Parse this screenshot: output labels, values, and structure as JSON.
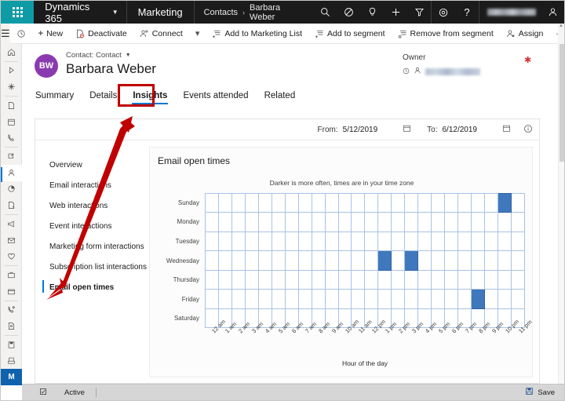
{
  "topnav": {
    "waffle_icon": "waffle-grid-icon",
    "brand": "Dynamics 365",
    "brand_chevron": "chevron-down-icon",
    "app_name": "Marketing",
    "breadcrumb": {
      "parent": "Contacts",
      "separator": "›",
      "current": "Barbara Weber"
    },
    "icons": [
      "search-icon",
      "focus-assist-icon",
      "lightbulb-idea-icon",
      "plus-new-icon",
      "filter-icon",
      "gear-settings-icon",
      "help-question-icon"
    ],
    "user_name_redacted": "",
    "person_icon": "person-icon"
  },
  "commandbar": {
    "hamburger_icon": "hamburger-menu-icon",
    "history_icon": "recent-history-icon",
    "buttons": [
      {
        "label": "New",
        "icon": "plus-icon"
      },
      {
        "label": "Deactivate",
        "icon": "deactivate-icon"
      },
      {
        "label": "Connect",
        "icon": "connect-icon"
      },
      {
        "label": "",
        "icon": "chevron-down-icon"
      },
      {
        "label": "Add to Marketing List",
        "icon": "add-list-icon"
      },
      {
        "label": "Add to segment",
        "icon": "add-segment-icon"
      },
      {
        "label": "Remove from segment",
        "icon": "remove-segment-icon"
      },
      {
        "label": "Assign",
        "icon": "assign-person-icon"
      },
      {
        "label": "···",
        "icon": "overflow-ellipsis-icon"
      }
    ]
  },
  "rail": {
    "items": [
      {
        "icon": "home-icon",
        "name": "home"
      },
      {
        "icon": "recent-icon",
        "name": "recent"
      },
      {
        "icon": "pinned-icon",
        "name": "pinned"
      },
      {
        "icon": "page-icon",
        "name": "page"
      },
      {
        "icon": "calendar-icon",
        "name": "calendar"
      },
      {
        "icon": "phone-icon",
        "name": "phone-calls"
      },
      {
        "icon": "share-icon",
        "name": "activities"
      },
      {
        "icon": "contact-person-icon",
        "name": "contacts"
      },
      {
        "icon": "pie-chart-icon",
        "name": "dashboards"
      },
      {
        "icon": "document-report-icon",
        "name": "reports"
      },
      {
        "icon": "megaphone-icon",
        "name": "campaigns"
      },
      {
        "icon": "envelope-icon",
        "name": "emails"
      },
      {
        "icon": "heart-icon",
        "name": "leads"
      },
      {
        "icon": "briefcase-icon",
        "name": "accounts"
      },
      {
        "icon": "folder-icon",
        "name": "folders"
      },
      {
        "icon": "phone-link-icon",
        "name": "phone-link"
      },
      {
        "icon": "form-person-icon",
        "name": "marketing-forms"
      },
      {
        "icon": "save-page-icon",
        "name": "saved-pages"
      },
      {
        "icon": "printer-icon",
        "name": "print"
      },
      {
        "icon": "calculator-icon",
        "name": "calculator"
      }
    ],
    "selected_index": 7,
    "badge": "M"
  },
  "record": {
    "avatar_initials": "BW",
    "type_label": "Contact: Contact",
    "type_chevron": "chevron-down-icon",
    "name": "Barbara Weber",
    "owner_label": "Owner",
    "owner_lookup_icon": "lookup-clock-icon",
    "owner_person_icon": "person-icon",
    "required_marker": "✱"
  },
  "tabs": {
    "items": [
      "Summary",
      "Details",
      "Insights",
      "Events attended",
      "Related"
    ],
    "active": "Insights",
    "highlight_color": "#c00000"
  },
  "insights": {
    "daterange": {
      "from_label": "From:",
      "from_value": "5/12/2019",
      "from_calendar_icon": "calendar-icon",
      "to_label": "To:",
      "to_value": "6/12/2019",
      "to_calendar_icon": "calendar-icon",
      "info_icon": "info-circle-icon"
    },
    "sidelist": {
      "items": [
        "Overview",
        "Email interactions",
        "Web interactions",
        "Event interactions",
        "Marketing form interactions",
        "Subscription list interactions",
        "Email open times"
      ],
      "selected": "Email open times"
    }
  },
  "chart_data": {
    "type": "heatmap",
    "title": "Email open times",
    "subtitle": "Darker is more often, times are in your time zone",
    "xlabel": "Hour of the day",
    "ylabel": "",
    "grid": true,
    "cell_color_on": "#3f78bd",
    "cell_color_off": "#ffffff",
    "grid_line_color": "#a9c3e4",
    "categories": [
      "12 am",
      "1 am",
      "2 am",
      "3 am",
      "4 am",
      "5 am",
      "6 am",
      "7 am",
      "8 am",
      "9 am",
      "10 am",
      "11 am",
      "12 pm",
      "1 pm",
      "2 pm",
      "3 pm",
      "4 pm",
      "5 pm",
      "6 pm",
      "7 pm",
      "8 pm",
      "9 pm",
      "10 pm",
      "11 pm"
    ],
    "rows": [
      "Sunday",
      "Monday",
      "Tuesday",
      "Wednesday",
      "Thursday",
      "Friday",
      "Saturday"
    ],
    "values": [
      [
        0,
        0,
        0,
        0,
        0,
        0,
        0,
        0,
        0,
        0,
        0,
        0,
        0,
        0,
        0,
        0,
        0,
        0,
        0,
        0,
        0,
        0,
        1,
        0
      ],
      [
        0,
        0,
        0,
        0,
        0,
        0,
        0,
        0,
        0,
        0,
        0,
        0,
        0,
        0,
        0,
        0,
        0,
        0,
        0,
        0,
        0,
        0,
        0,
        0
      ],
      [
        0,
        0,
        0,
        0,
        0,
        0,
        0,
        0,
        0,
        0,
        0,
        0,
        0,
        0,
        0,
        0,
        0,
        0,
        0,
        0,
        0,
        0,
        0,
        0
      ],
      [
        0,
        0,
        0,
        0,
        0,
        0,
        0,
        0,
        0,
        0,
        0,
        0,
        0,
        1,
        0,
        1,
        0,
        0,
        0,
        0,
        0,
        0,
        0,
        0
      ],
      [
        0,
        0,
        0,
        0,
        0,
        0,
        0,
        0,
        0,
        0,
        0,
        0,
        0,
        0,
        0,
        0,
        0,
        0,
        0,
        0,
        0,
        0,
        0,
        0
      ],
      [
        0,
        0,
        0,
        0,
        0,
        0,
        0,
        0,
        0,
        0,
        0,
        0,
        0,
        0,
        0,
        0,
        0,
        0,
        0,
        0,
        1,
        0,
        0,
        0
      ],
      [
        0,
        0,
        0,
        0,
        0,
        0,
        0,
        0,
        0,
        0,
        0,
        0,
        0,
        0,
        0,
        0,
        0,
        0,
        0,
        0,
        0,
        0,
        0,
        0
      ]
    ],
    "highlighted_cells": [
      {
        "day": "Sunday",
        "hour": "10 pm"
      },
      {
        "day": "Wednesday",
        "hour": "1 pm"
      },
      {
        "day": "Wednesday",
        "hour": "3 pm"
      },
      {
        "day": "Friday",
        "hour": "8 pm"
      }
    ]
  },
  "statusbar": {
    "lock_icon": "edit-status-icon",
    "state": "Active",
    "save_label": "Save",
    "save_icon": "save-disk-icon"
  }
}
